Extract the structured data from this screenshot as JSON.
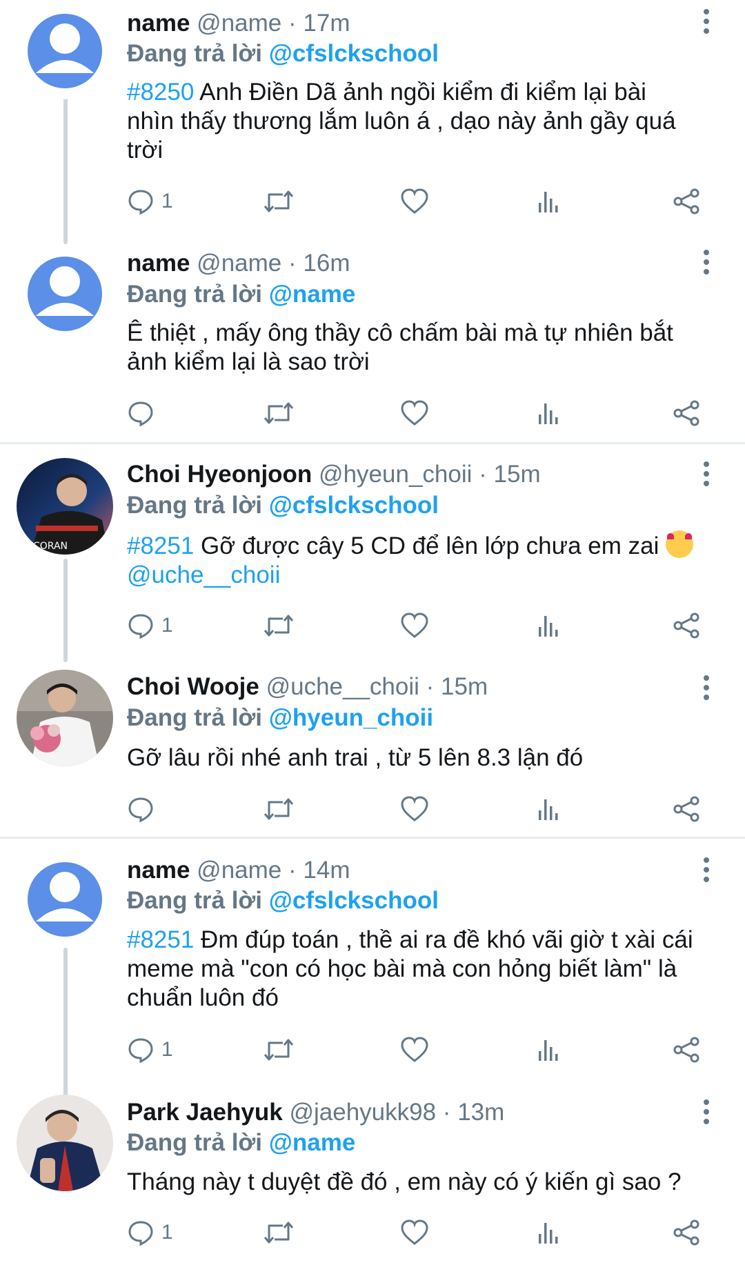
{
  "colors": {
    "accent": "#1da1f2",
    "muted": "#657786",
    "text": "#14171a",
    "thread": "#ccd6dd"
  },
  "icons": {
    "reply": "comment-bubble-icon",
    "retweet": "retweet-icon",
    "like": "heart-icon",
    "stats": "bar-chart-icon",
    "share": "share-icon",
    "menu": "more-vertical-icon"
  },
  "tweets": [
    {
      "name": "name",
      "handle": "@name",
      "dot": "·",
      "time": "17m",
      "reply_prefix": "Đang trả lời",
      "reply_target": "@cfslckschool",
      "hashtag": "#8250",
      "lines": [
        " Anh Điền Dã ảnh ngồi kiểm đi kiểm lại bài",
        "nhìn thấy thương lắm luôn á , dạo này ảnh gầy quá",
        "trời"
      ],
      "reply_count": "1"
    },
    {
      "name": "name",
      "handle": "@name",
      "dot": "·",
      "time": "16m",
      "reply_prefix": "Đang trả lời",
      "reply_target": "@name",
      "lines": [
        "Ê thiệt , mấy ông thầy cô chấm bài mà tự nhiên bắt",
        "ảnh kiểm lại là sao trời"
      ],
      "reply_count": ""
    },
    {
      "name": "Choi Hyeonjoon",
      "handle": "@hyeun_choii",
      "dot": "·",
      "time": "15m",
      "reply_prefix": "Đang trả lời",
      "reply_target": "@cfslckschool",
      "hashtag": "#8251",
      "lines": [
        " Gỡ được cây 5 CD để lên lớp chưa em zai "
      ],
      "mention": "@uche__choii",
      "reply_count": "1",
      "avatar_text": "CORAN"
    },
    {
      "name": "Choi Wooje",
      "handle": "@uche__choii",
      "dot": "·",
      "time": "15m",
      "reply_prefix": "Đang trả lời",
      "reply_target": "@hyeun_choii",
      "lines": [
        "Gỡ lâu rồi nhé anh trai , từ 5 lên 8.3 lận đó"
      ],
      "reply_count": ""
    },
    {
      "name": "name",
      "handle": "@name",
      "dot": "·",
      "time": "14m",
      "reply_prefix": "Đang trả lời",
      "reply_target": "@cfslckschool",
      "hashtag": "#8251",
      "lines": [
        " Đm đúp toán , thề ai ra đề khó vãi giờ t xài cái",
        "meme mà \"con có học bài mà con hỏng biết làm\" là",
        "chuẩn luôn đó"
      ],
      "reply_count": "1"
    },
    {
      "name": "Park Jaehyuk",
      "handle": "@jaehyukk98",
      "dot": "·",
      "time": "13m",
      "reply_prefix": "Đang trả lời",
      "reply_target": "@name",
      "lines": [
        "Tháng này t duyệt đề đó , em này có ý kiến gì sao ?"
      ],
      "reply_count": "1"
    }
  ]
}
